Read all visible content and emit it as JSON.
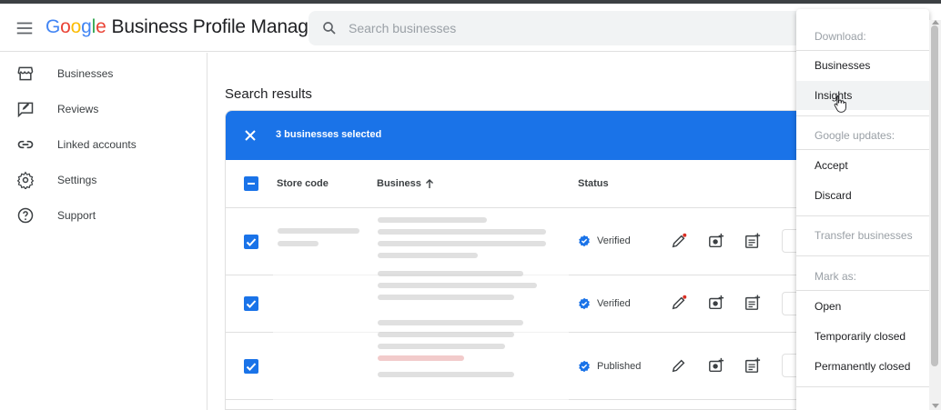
{
  "app": {
    "logo_letters": [
      "G",
      "o",
      "o",
      "g",
      "l",
      "e"
    ],
    "logo_rest": "Business Profile Manager"
  },
  "search": {
    "placeholder": "Search businesses"
  },
  "sidebar": {
    "items": [
      {
        "label": "Businesses",
        "icon": "store-icon"
      },
      {
        "label": "Reviews",
        "icon": "reviews-icon"
      },
      {
        "label": "Linked accounts",
        "icon": "link-icon"
      },
      {
        "label": "Settings",
        "icon": "gear-icon"
      },
      {
        "label": "Support",
        "icon": "help-icon"
      }
    ]
  },
  "main": {
    "title": "Search results",
    "selection_text": "3 businesses selected",
    "columns": {
      "store_code": "Store code",
      "business": "Business",
      "status": "Status"
    },
    "rows": [
      {
        "status": "Verified",
        "checked": true
      },
      {
        "status": "Verified",
        "checked": true
      },
      {
        "status": "Published",
        "checked": true
      }
    ]
  },
  "menu": {
    "download_header": "Download:",
    "businesses": "Businesses",
    "insights": "Insights",
    "updates_header": "Google updates:",
    "accept": "Accept",
    "discard": "Discard",
    "transfer": "Transfer businesses",
    "mark_header": "Mark as:",
    "open": "Open",
    "temp_closed": "Temporarily closed",
    "perm_closed": "Permanently closed"
  },
  "colors": {
    "accent": "#1a73e8",
    "verified": "#1a73e8",
    "badge_dot": "#d93025"
  }
}
